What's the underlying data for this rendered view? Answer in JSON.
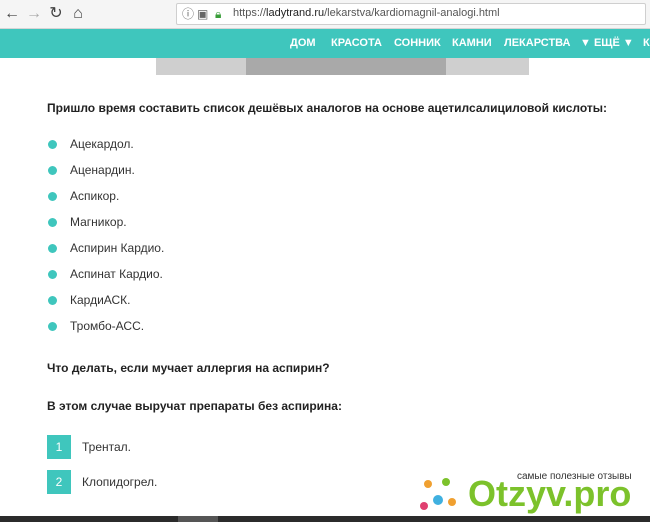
{
  "browser": {
    "back_icon": "back-arrow-icon",
    "forward_icon": "forward-arrow-icon",
    "reload_icon": "reload-icon",
    "home_icon": "home-icon",
    "url_scheme": "https://",
    "url_host": "ladytrand.ru",
    "url_path": "/lekarstva/kardiomagnil-analogi.html"
  },
  "site_nav": {
    "items": [
      "ДОМ",
      "КРАСОТА",
      "СОННИК",
      "КАМНИ",
      "ЛЕКАРСТВА",
      "▼ ЕЩЁ ▼",
      "К"
    ],
    "color": "#3fc6bd"
  },
  "article": {
    "intro_heading": "Пришло время составить список дешёвых аналогов на основе ацетилсалициловой кислоты:",
    "analogs": [
      "Ацекардол.",
      "Аценардин.",
      "Аспикор.",
      "Магникор.",
      "Аспирин Кардио.",
      "Аспинат Кардио.",
      "КардиАСК.",
      "Тромбо-АСС."
    ],
    "allergy_heading": "Что делать, если мучает аллергия на аспирин?",
    "alternatives_heading": "В этом случае выручат препараты без аспирина:",
    "alternatives": [
      {
        "num": "1",
        "label": "Трентал."
      },
      {
        "num": "2",
        "label": "Клопидогрел."
      }
    ]
  },
  "watermark": {
    "tagline": "самые полезные отзывы",
    "logo_text": "Otzyv.pro"
  }
}
